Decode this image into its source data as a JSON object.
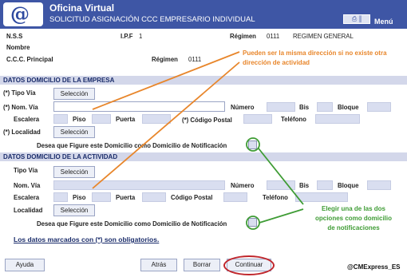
{
  "header": {
    "title": "Oficina Virtual",
    "subtitle": "SOLICITUD ASIGNACIÓN CCC EMPRESARIO INDIVIDUAL",
    "logo_text": "@",
    "print_icon": "print-icon",
    "menu_label": "Menú"
  },
  "info": {
    "nss_label": "N.S.S",
    "ipf_label": "I.P.F",
    "ipf_value": "1",
    "regimen_label": "Régimen",
    "regimen_value": "0111",
    "regimen_name": "REGIMEN GENERAL",
    "nombre_label": "Nombre",
    "ccc_label": "C.C.C. Principal",
    "ccc_regimen_label": "Régimen",
    "ccc_regimen_value": "0111"
  },
  "empresa": {
    "section_title": "DATOS DOMICILIO DE LA EMPRESA",
    "tipo_via_label": "(*) Tipo Vía",
    "seleccion_label": "Selección",
    "nom_via_label": "(*) Nom. Vía",
    "numero_label": "Número",
    "bis_label": "Bis",
    "bloque_label": "Bloque",
    "escalera_label": "Escalera",
    "piso_label": "Piso",
    "puerta_label": "Puerta",
    "codigo_postal_label": "(*) Código Postal",
    "telefono_label": "Teléfono",
    "localidad_label": "(*) Localidad",
    "localidad_button": "Selección",
    "notificacion_label": "Desea que Figure este Domicilio como Domicilio de Notificación"
  },
  "actividad": {
    "section_title": "DATOS DOMICILIO DE LA ACTIVIDAD",
    "tipo_via_label": "Tipo Vía",
    "seleccion_label": "Selección",
    "nom_via_label": "Nom. Vía",
    "numero_label": "Número",
    "bis_label": "Bis",
    "bloque_label": "Bloque",
    "escalera_label": "Escalera",
    "piso_label": "Piso",
    "puerta_label": "Puerta",
    "codigo_postal_label": "Código Postal",
    "telefono_label": "Teléfono",
    "localidad_label": "Localidad",
    "localidad_button": "Selección",
    "notificacion_label": "Desea que Figure este Domicilio como Domicilio de Notificación"
  },
  "annotations": {
    "orange_line1": "Pueden ser la misma dirección si no existe otra",
    "orange_line2": "dirección de actividad",
    "green_line1": "Elegir una de las dos",
    "green_line2": "opciones como domicilio",
    "green_line3": "de notificaciones",
    "orange_color": "#e8862b",
    "green_color": "#3f9c35"
  },
  "footer": {
    "required_note": "Los datos marcados con (*) son obligatorios.",
    "ayuda_label": "Ayuda",
    "atras_label": "Atrás",
    "borrar_label": "Borrar",
    "continuar_label": "Continuar",
    "watermark": "@CMExpress_ES"
  },
  "colors": {
    "header": "#3e56a5",
    "section_bar": "#d3d7ea",
    "field": "#d9def0",
    "highlight_ring": "#c0262c"
  }
}
